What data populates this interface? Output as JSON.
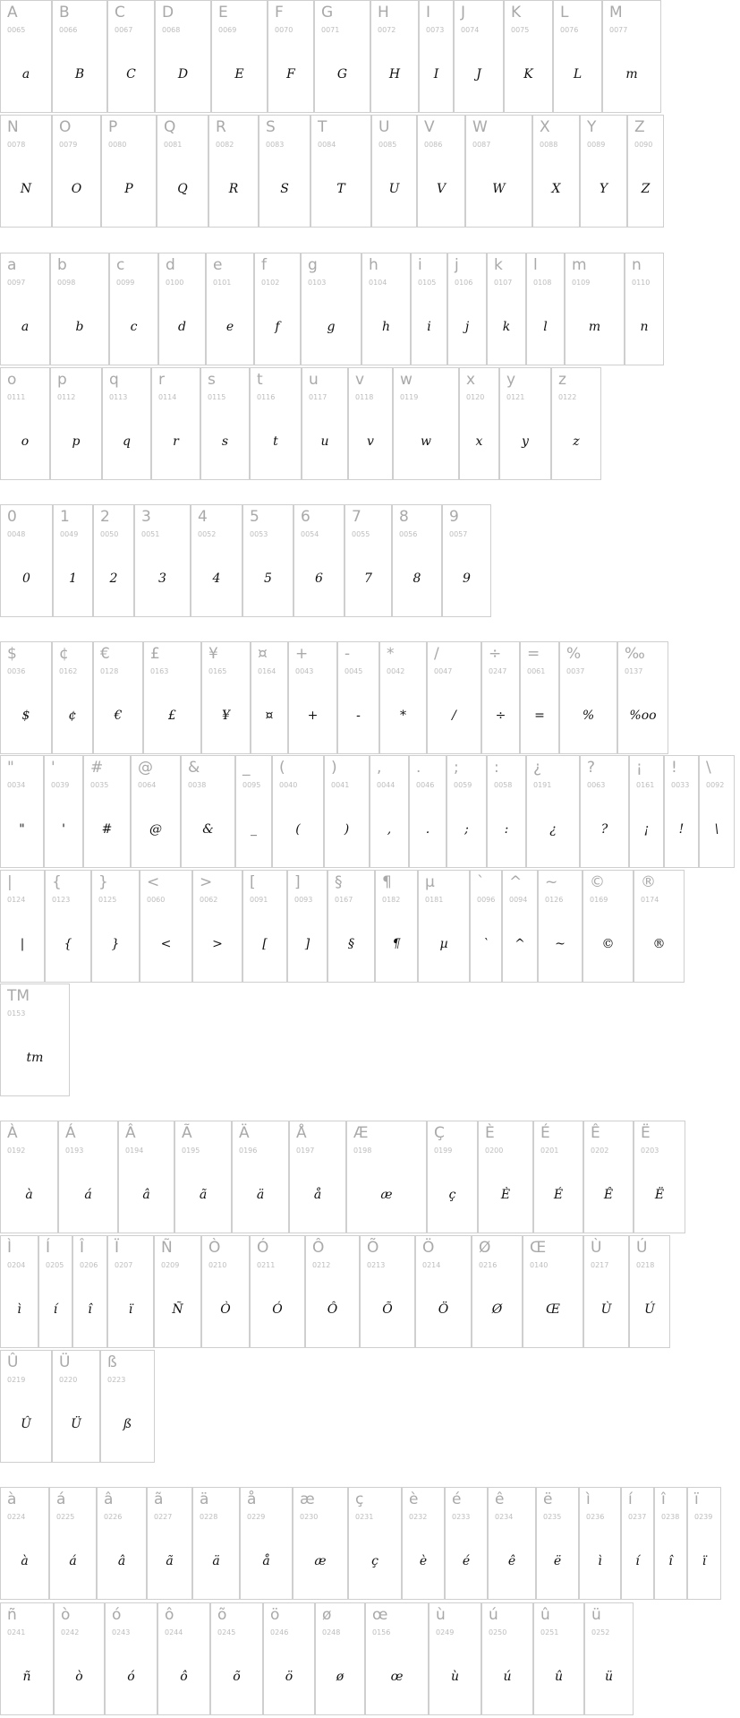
{
  "sections": [
    {
      "id": "uppercase",
      "rows": [
        [
          {
            "label": "A",
            "code": "0065",
            "glyph": "a"
          },
          {
            "label": "B",
            "code": "0066",
            "glyph": "B"
          },
          {
            "label": "C",
            "code": "0067",
            "glyph": "C"
          },
          {
            "label": "D",
            "code": "0068",
            "glyph": "D"
          },
          {
            "label": "E",
            "code": "0069",
            "glyph": "E"
          },
          {
            "label": "F",
            "code": "0070",
            "glyph": "F"
          },
          {
            "label": "G",
            "code": "0071",
            "glyph": "G"
          },
          {
            "label": "H",
            "code": "0072",
            "glyph": "H"
          },
          {
            "label": "I",
            "code": "0073",
            "glyph": "I"
          },
          {
            "label": "J",
            "code": "0074",
            "glyph": "J"
          },
          {
            "label": "K",
            "code": "0075",
            "glyph": "K"
          },
          {
            "label": "L",
            "code": "0076",
            "glyph": "L"
          },
          {
            "label": "M",
            "code": "0077",
            "glyph": "m"
          }
        ],
        [
          {
            "label": "N",
            "code": "0078",
            "glyph": "N"
          },
          {
            "label": "O",
            "code": "0079",
            "glyph": "O"
          },
          {
            "label": "P",
            "code": "0080",
            "glyph": "P"
          },
          {
            "label": "Q",
            "code": "0081",
            "glyph": "Q"
          },
          {
            "label": "R",
            "code": "0082",
            "glyph": "R"
          },
          {
            "label": "S",
            "code": "0083",
            "glyph": "S"
          },
          {
            "label": "T",
            "code": "0084",
            "glyph": "T"
          },
          {
            "label": "U",
            "code": "0085",
            "glyph": "U"
          },
          {
            "label": "V",
            "code": "0086",
            "glyph": "V"
          },
          {
            "label": "W",
            "code": "0087",
            "glyph": "W"
          },
          {
            "label": "X",
            "code": "0088",
            "glyph": "X"
          },
          {
            "label": "Y",
            "code": "0089",
            "glyph": "Y"
          },
          {
            "label": "Z",
            "code": "0090",
            "glyph": "Z"
          }
        ]
      ]
    },
    {
      "id": "lowercase",
      "rows": [
        [
          {
            "label": "a",
            "code": "0097",
            "glyph": "a"
          },
          {
            "label": "b",
            "code": "0098",
            "glyph": "b"
          },
          {
            "label": "c",
            "code": "0099",
            "glyph": "c"
          },
          {
            "label": "d",
            "code": "0100",
            "glyph": "d"
          },
          {
            "label": "e",
            "code": "0101",
            "glyph": "e"
          },
          {
            "label": "f",
            "code": "0102",
            "glyph": "f"
          },
          {
            "label": "g",
            "code": "0103",
            "glyph": "g"
          },
          {
            "label": "h",
            "code": "0104",
            "glyph": "h"
          },
          {
            "label": "i",
            "code": "0105",
            "glyph": "i"
          },
          {
            "label": "j",
            "code": "0106",
            "glyph": "j"
          },
          {
            "label": "k",
            "code": "0107",
            "glyph": "k"
          },
          {
            "label": "l",
            "code": "0108",
            "glyph": "l"
          },
          {
            "label": "m",
            "code": "0109",
            "glyph": "m"
          },
          {
            "label": "n",
            "code": "0110",
            "glyph": "n"
          }
        ],
        [
          {
            "label": "o",
            "code": "0111",
            "glyph": "o"
          },
          {
            "label": "p",
            "code": "0112",
            "glyph": "p"
          },
          {
            "label": "q",
            "code": "0113",
            "glyph": "q"
          },
          {
            "label": "r",
            "code": "0114",
            "glyph": "r"
          },
          {
            "label": "s",
            "code": "0115",
            "glyph": "s"
          },
          {
            "label": "t",
            "code": "0116",
            "glyph": "t"
          },
          {
            "label": "u",
            "code": "0117",
            "glyph": "u"
          },
          {
            "label": "v",
            "code": "0118",
            "glyph": "v"
          },
          {
            "label": "w",
            "code": "0119",
            "glyph": "w"
          },
          {
            "label": "x",
            "code": "0120",
            "glyph": "x"
          },
          {
            "label": "y",
            "code": "0121",
            "glyph": "y"
          },
          {
            "label": "z",
            "code": "0122",
            "glyph": "z"
          }
        ]
      ]
    },
    {
      "id": "digits",
      "rows": [
        [
          {
            "label": "0",
            "code": "0048",
            "glyph": "0"
          },
          {
            "label": "1",
            "code": "0049",
            "glyph": "1"
          },
          {
            "label": "2",
            "code": "0050",
            "glyph": "2"
          },
          {
            "label": "3",
            "code": "0051",
            "glyph": "3"
          },
          {
            "label": "4",
            "code": "0052",
            "glyph": "4"
          },
          {
            "label": "5",
            "code": "0053",
            "glyph": "5"
          },
          {
            "label": "6",
            "code": "0054",
            "glyph": "6"
          },
          {
            "label": "7",
            "code": "0055",
            "glyph": "7"
          },
          {
            "label": "8",
            "code": "0056",
            "glyph": "8"
          },
          {
            "label": "9",
            "code": "0057",
            "glyph": "9"
          }
        ]
      ]
    },
    {
      "id": "symbols",
      "rows": [
        [
          {
            "label": "$",
            "code": "0036",
            "glyph": "$"
          },
          {
            "label": "¢",
            "code": "0162",
            "glyph": "¢"
          },
          {
            "label": "€",
            "code": "0128",
            "glyph": "€"
          },
          {
            "label": "£",
            "code": "0163",
            "glyph": "£"
          },
          {
            "label": "¥",
            "code": "0165",
            "glyph": "¥"
          },
          {
            "label": "¤",
            "code": "0164",
            "glyph": "¤"
          },
          {
            "label": "+",
            "code": "0043",
            "glyph": "+"
          },
          {
            "label": "-",
            "code": "0045",
            "glyph": "-"
          },
          {
            "label": "*",
            "code": "0042",
            "glyph": "*"
          },
          {
            "label": "/",
            "code": "0047",
            "glyph": "/"
          },
          {
            "label": "÷",
            "code": "0247",
            "glyph": "÷"
          },
          {
            "label": "=",
            "code": "0061",
            "glyph": "="
          },
          {
            "label": "%",
            "code": "0037",
            "glyph": "%"
          },
          {
            "label": "‰",
            "code": "0137",
            "glyph": "%oo"
          }
        ],
        [
          {
            "label": "\"",
            "code": "0034",
            "glyph": "\""
          },
          {
            "label": "'",
            "code": "0039",
            "glyph": "'"
          },
          {
            "label": "#",
            "code": "0035",
            "glyph": "#"
          },
          {
            "label": "@",
            "code": "0064",
            "glyph": "@"
          },
          {
            "label": "&",
            "code": "0038",
            "glyph": "&"
          },
          {
            "label": "_",
            "code": "0095",
            "glyph": "_"
          },
          {
            "label": "(",
            "code": "0040",
            "glyph": "("
          },
          {
            "label": ")",
            "code": "0041",
            "glyph": ")"
          },
          {
            "label": ",",
            "code": "0044",
            "glyph": ","
          },
          {
            "label": ".",
            "code": "0046",
            "glyph": "."
          },
          {
            "label": ";",
            "code": "0059",
            "glyph": ";"
          },
          {
            "label": ":",
            "code": "0058",
            "glyph": ":"
          },
          {
            "label": "¿",
            "code": "0191",
            "glyph": "¿"
          },
          {
            "label": "?",
            "code": "0063",
            "glyph": "?"
          },
          {
            "label": "¡",
            "code": "0161",
            "glyph": "¡"
          },
          {
            "label": "!",
            "code": "0033",
            "glyph": "!"
          },
          {
            "label": "\\",
            "code": "0092",
            "glyph": "\\"
          }
        ],
        [
          {
            "label": "|",
            "code": "0124",
            "glyph": "|"
          },
          {
            "label": "{",
            "code": "0123",
            "glyph": "{"
          },
          {
            "label": "}",
            "code": "0125",
            "glyph": "}"
          },
          {
            "label": "<",
            "code": "0060",
            "glyph": "<"
          },
          {
            "label": ">",
            "code": "0062",
            "glyph": ">"
          },
          {
            "label": "[",
            "code": "0091",
            "glyph": "["
          },
          {
            "label": "]",
            "code": "0093",
            "glyph": "]"
          },
          {
            "label": "§",
            "code": "0167",
            "glyph": "§"
          },
          {
            "label": "¶",
            "code": "0182",
            "glyph": "¶"
          },
          {
            "label": "µ",
            "code": "0181",
            "glyph": "µ"
          },
          {
            "label": "`",
            "code": "0096",
            "glyph": "`"
          },
          {
            "label": "^",
            "code": "0094",
            "glyph": "^"
          },
          {
            "label": "~",
            "code": "0126",
            "glyph": "~"
          },
          {
            "label": "©",
            "code": "0169",
            "glyph": "©"
          },
          {
            "label": "®",
            "code": "0174",
            "glyph": "®"
          }
        ],
        [
          {
            "label": "TM",
            "code": "0153",
            "glyph": "tm"
          }
        ]
      ]
    },
    {
      "id": "accented-uppercase",
      "rows": [
        [
          {
            "label": "À",
            "code": "0192",
            "glyph": "à"
          },
          {
            "label": "Á",
            "code": "0193",
            "glyph": "á"
          },
          {
            "label": "Â",
            "code": "0194",
            "glyph": "â"
          },
          {
            "label": "Ã",
            "code": "0195",
            "glyph": "ã"
          },
          {
            "label": "Ä",
            "code": "0196",
            "glyph": "ä"
          },
          {
            "label": "Å",
            "code": "0197",
            "glyph": "å"
          },
          {
            "label": "Æ",
            "code": "0198",
            "glyph": "æ"
          },
          {
            "label": "Ç",
            "code": "0199",
            "glyph": "ç"
          },
          {
            "label": "È",
            "code": "0200",
            "glyph": "È"
          },
          {
            "label": "É",
            "code": "0201",
            "glyph": "É"
          },
          {
            "label": "Ê",
            "code": "0202",
            "glyph": "Ê"
          },
          {
            "label": "Ë",
            "code": "0203",
            "glyph": "Ë"
          }
        ],
        [
          {
            "label": "Ì",
            "code": "0204",
            "glyph": "ì"
          },
          {
            "label": "Í",
            "code": "0205",
            "glyph": "í"
          },
          {
            "label": "Î",
            "code": "0206",
            "glyph": "î"
          },
          {
            "label": "Ï",
            "code": "0207",
            "glyph": "ï"
          },
          {
            "label": "Ñ",
            "code": "0209",
            "glyph": "Ñ"
          },
          {
            "label": "Ò",
            "code": "0210",
            "glyph": "Ò"
          },
          {
            "label": "Ó",
            "code": "0211",
            "glyph": "Ó"
          },
          {
            "label": "Ô",
            "code": "0212",
            "glyph": "Ô"
          },
          {
            "label": "Õ",
            "code": "0213",
            "glyph": "Õ"
          },
          {
            "label": "Ö",
            "code": "0214",
            "glyph": "Ö"
          },
          {
            "label": "Ø",
            "code": "0216",
            "glyph": "Ø"
          },
          {
            "label": "Œ",
            "code": "0140",
            "glyph": "Œ"
          },
          {
            "label": "Ù",
            "code": "0217",
            "glyph": "Ù"
          },
          {
            "label": "Ú",
            "code": "0218",
            "glyph": "Ú"
          }
        ],
        [
          {
            "label": "Û",
            "code": "0219",
            "glyph": "Û"
          },
          {
            "label": "Ü",
            "code": "0220",
            "glyph": "Ü"
          },
          {
            "label": "ß",
            "code": "0223",
            "glyph": "ß"
          }
        ]
      ]
    },
    {
      "id": "accented-lowercase",
      "rows": [
        [
          {
            "label": "à",
            "code": "0224",
            "glyph": "à"
          },
          {
            "label": "á",
            "code": "0225",
            "glyph": "á"
          },
          {
            "label": "â",
            "code": "0226",
            "glyph": "â"
          },
          {
            "label": "ã",
            "code": "0227",
            "glyph": "ã"
          },
          {
            "label": "ä",
            "code": "0228",
            "glyph": "ä"
          },
          {
            "label": "å",
            "code": "0229",
            "glyph": "å"
          },
          {
            "label": "æ",
            "code": "0230",
            "glyph": "æ"
          },
          {
            "label": "ç",
            "code": "0231",
            "glyph": "ç"
          },
          {
            "label": "è",
            "code": "0232",
            "glyph": "è"
          },
          {
            "label": "é",
            "code": "0233",
            "glyph": "é"
          },
          {
            "label": "ê",
            "code": "0234",
            "glyph": "ê"
          },
          {
            "label": "ë",
            "code": "0235",
            "glyph": "ë"
          },
          {
            "label": "ì",
            "code": "0236",
            "glyph": "ì"
          },
          {
            "label": "í",
            "code": "0237",
            "glyph": "í"
          },
          {
            "label": "î",
            "code": "0238",
            "glyph": "î"
          },
          {
            "label": "ï",
            "code": "0239",
            "glyph": "ï"
          }
        ],
        [
          {
            "label": "ñ",
            "code": "0241",
            "glyph": "ñ"
          },
          {
            "label": "ò",
            "code": "0242",
            "glyph": "ò"
          },
          {
            "label": "ó",
            "code": "0243",
            "glyph": "ó"
          },
          {
            "label": "ô",
            "code": "0244",
            "glyph": "ô"
          },
          {
            "label": "õ",
            "code": "0245",
            "glyph": "õ"
          },
          {
            "label": "ö",
            "code": "0246",
            "glyph": "ö"
          },
          {
            "label": "ø",
            "code": "0248",
            "glyph": "ø"
          },
          {
            "label": "œ",
            "code": "0156",
            "glyph": "œ"
          },
          {
            "label": "ù",
            "code": "0249",
            "glyph": "ù"
          },
          {
            "label": "ú",
            "code": "0250",
            "glyph": "ú"
          },
          {
            "label": "û",
            "code": "0251",
            "glyph": "û"
          },
          {
            "label": "ü",
            "code": "0252",
            "glyph": "ü"
          }
        ]
      ]
    }
  ]
}
